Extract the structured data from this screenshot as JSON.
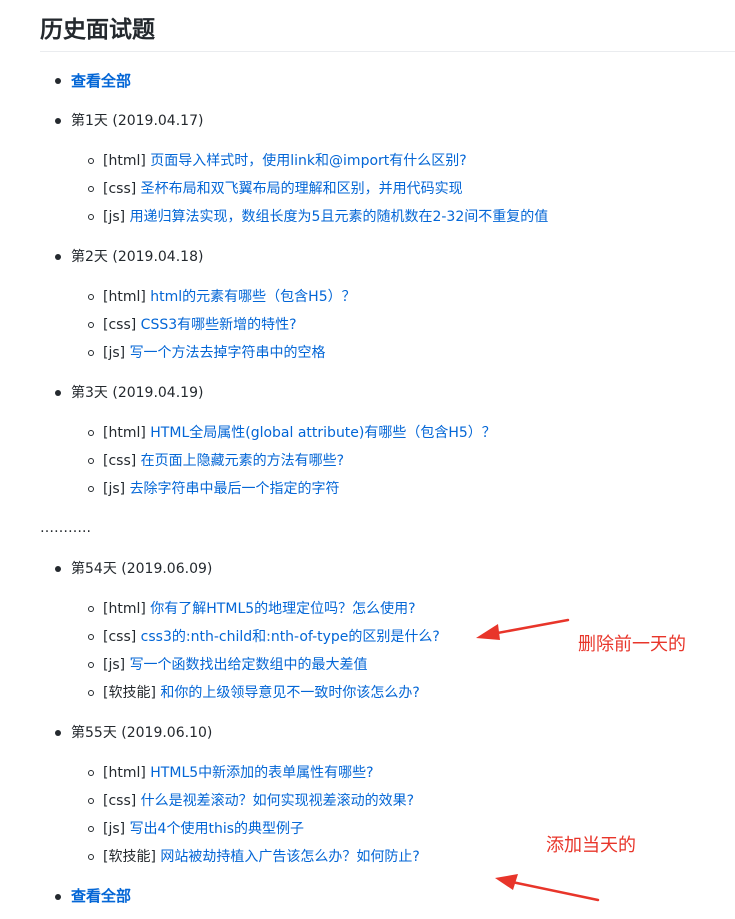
{
  "title": "历史面试题",
  "view_all_label": "查看全部",
  "ellipsis": "………..",
  "days": [
    {
      "label": "第1天 (2019.04.17)",
      "items": [
        {
          "tag": "[html]",
          "text": "页面导入样式时，使用link和@import有什么区别?"
        },
        {
          "tag": "[css]",
          "text": "圣杯布局和双飞翼布局的理解和区别，并用代码实现"
        },
        {
          "tag": "[js]",
          "text": "用递归算法实现，数组长度为5且元素的随机数在2-32间不重复的值"
        }
      ]
    },
    {
      "label": "第2天 (2019.04.18)",
      "items": [
        {
          "tag": "[html]",
          "text": "html的元素有哪些（包含H5）？"
        },
        {
          "tag": "[css]",
          "text": "CSS3有哪些新增的特性?"
        },
        {
          "tag": "[js]",
          "text": "写一个方法去掉字符串中的空格"
        }
      ]
    },
    {
      "label": "第3天 (2019.04.19)",
      "items": [
        {
          "tag": "[html]",
          "text": "HTML全局属性(global attribute)有哪些（包含H5）？"
        },
        {
          "tag": "[css]",
          "text": "在页面上隐藏元素的方法有哪些?"
        },
        {
          "tag": "[js]",
          "text": "去除字符串中最后一个指定的字符"
        }
      ]
    },
    {
      "label": "第54天 (2019.06.09)",
      "items": [
        {
          "tag": "[html]",
          "text": "你有了解HTML5的地理定位吗？怎么使用?"
        },
        {
          "tag": "[css]",
          "text": "css3的:nth-child和:nth-of-type的区别是什么?"
        },
        {
          "tag": "[js]",
          "text": "写一个函数找出给定数组中的最大差值"
        },
        {
          "tag": "[软技能]",
          "text": "和你的上级领导意见不一致时你该怎么办?"
        }
      ]
    },
    {
      "label": "第55天 (2019.06.10)",
      "items": [
        {
          "tag": "[html]",
          "text": "HTML5中新添加的表单属性有哪些?"
        },
        {
          "tag": "[css]",
          "text": "什么是视差滚动？如何实现视差滚动的效果?"
        },
        {
          "tag": "[js]",
          "text": "写出4个使用this的典型例子"
        },
        {
          "tag": "[软技能]",
          "text": "网站被劫持植入广告该怎么办？如何防止?"
        }
      ]
    }
  ],
  "annotations": {
    "delete_prev": "删除前一天的",
    "add_today": "添加当天的"
  },
  "colors": {
    "link": "#0366d6",
    "text": "#24292e",
    "annotation": "#e8352a",
    "rule": "#eaecef"
  }
}
